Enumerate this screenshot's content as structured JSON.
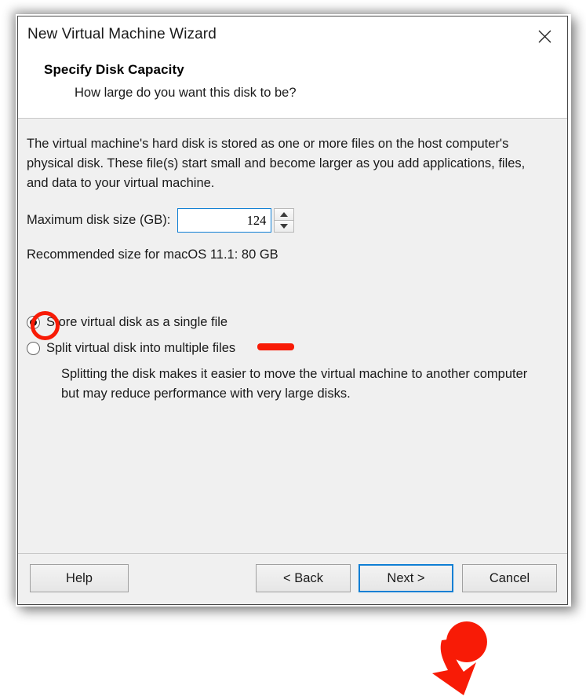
{
  "window": {
    "title": "New Virtual Machine Wizard",
    "close_icon": "close-icon"
  },
  "header": {
    "title": "Specify Disk Capacity",
    "subtitle": "How large do you want this disk to be?"
  },
  "body": {
    "intro": "The virtual machine's hard disk is stored as one or more files on the host computer's physical disk. These file(s) start small and become larger as you add applications, files, and data to your virtual machine.",
    "size_label": "Maximum disk size (GB):",
    "size_value": "124",
    "recommended": "Recommended size for macOS 11.1: 80 GB",
    "storage_options": [
      {
        "label": "Store virtual disk as a single file",
        "selected": true
      },
      {
        "label": "Split virtual disk into multiple files",
        "selected": false
      }
    ],
    "note": "Splitting the disk makes it easier to move the virtual machine to another computer but may reduce performance with very large disks."
  },
  "spinner": {
    "up_icon": "triangle-up-icon",
    "down_icon": "triangle-down-icon"
  },
  "footer": {
    "help": "Help",
    "back": "< Back",
    "next": "Next >",
    "cancel": "Cancel"
  },
  "annotations": {
    "highlight_color": "#f81b06",
    "focus_color": "#0f7fd4",
    "arrow": "red-arrow-pointing-to-next-button",
    "circle": "red-circle-around-single-file-radio",
    "underline": "red-underline-under-disk-size-value"
  }
}
